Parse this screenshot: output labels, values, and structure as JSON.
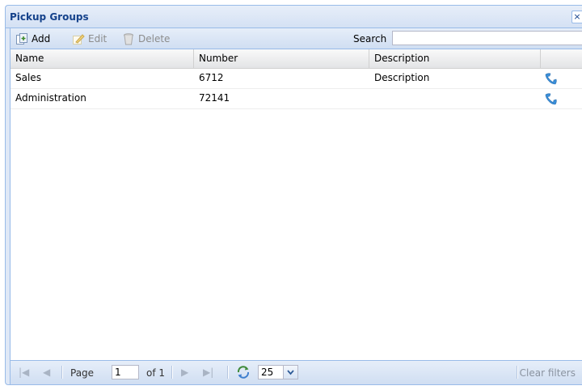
{
  "window": {
    "title": "Pickup Groups",
    "close_glyph": "×"
  },
  "toolbar": {
    "add_label": "Add",
    "edit_label": "Edit",
    "delete_label": "Delete",
    "search_label": "Search",
    "search_value": ""
  },
  "grid": {
    "columns": [
      "Name",
      "Number",
      "Description",
      ""
    ],
    "rows": [
      {
        "name": "Sales",
        "number": "6712",
        "description": "Description",
        "icon": "pickup-phone-icon"
      },
      {
        "name": "Administration",
        "number": "72141",
        "description": "",
        "icon": "pickup-phone-icon"
      }
    ]
  },
  "pager": {
    "page_label": "Page",
    "page_value": "1",
    "of_label": "of 1",
    "page_size": "25",
    "clear_filters_label": "Clear filters"
  },
  "colors": {
    "title_text": "#15428b",
    "border": "#99bbe8",
    "icon_blue": "#3b8fd9"
  }
}
